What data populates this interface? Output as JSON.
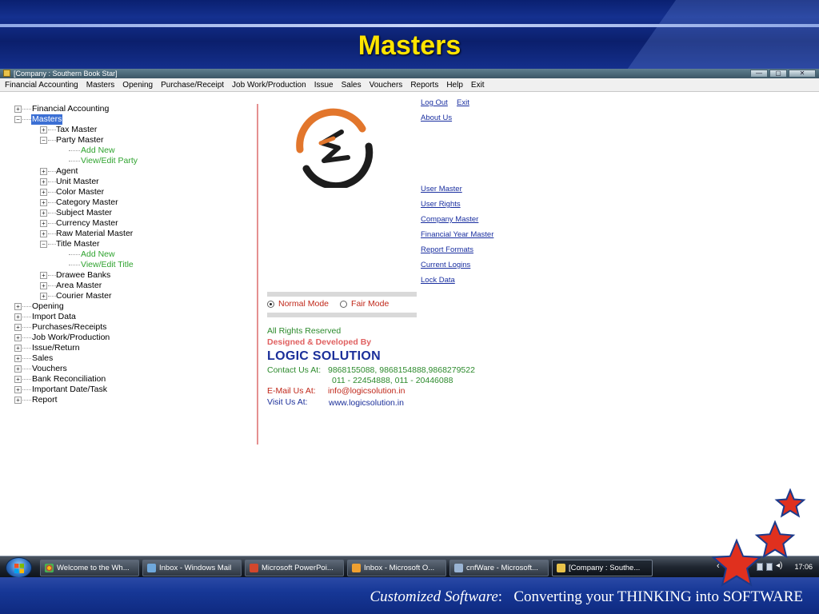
{
  "slide": {
    "title": "Masters",
    "tagline_em": "Customized Software",
    "tagline_colon": ":",
    "tagline_rest": "Converting your THINKING into SOFTWARE"
  },
  "window": {
    "title": "[Company : Southern Book Star]",
    "controls": [
      "—",
      "▢",
      "✕"
    ]
  },
  "menu": [
    "Financial Accounting",
    "Masters",
    "Opening",
    "Purchase/Receipt",
    "Job Work/Production",
    "Issue",
    "Sales",
    "Vouchers",
    "Reports",
    "Help",
    "Exit"
  ],
  "tree": {
    "financial_accounting": "Financial Accounting",
    "masters": "Masters",
    "tax_master": "Tax Master",
    "party_master": "Party Master",
    "party_add_new": "Add New",
    "party_view_edit": "View/Edit Party",
    "agent": "Agent",
    "unit_master": "Unit Master",
    "color_master": "Color Master",
    "category_master": "Category Master",
    "subject_master": "Subject Master",
    "currency_master": "Currency Master",
    "raw_material_master": "Raw Material Master",
    "title_master": "Title Master",
    "title_add_new": "Add New",
    "title_view_edit": "View/Edit Title",
    "drawee_banks": "Drawee Banks",
    "area_master": "Area Master",
    "courier_master": "Courier Master",
    "opening": "Opening",
    "import_data": "Import Data",
    "purchases_receipts": "Purchases/Receipts",
    "job_work_production": "Job Work/Production",
    "issue_return": "Issue/Return",
    "sales": "Sales",
    "vouchers": "Vouchers",
    "bank_reconciliation": "Bank Reconciliation",
    "important_date_task": "Important Date/Task",
    "report": "Report"
  },
  "links": {
    "log_out": "Log Out",
    "exit": "Exit",
    "about_us": "About Us",
    "user_master": "User Master",
    "user_rights": "User Rights",
    "company_master": "Company Master",
    "financial_year_master": "Financial Year Master",
    "report_formats": "Report Formats",
    "current_logins": "Current Logins",
    "lock_data": "Lock Data"
  },
  "modes": {
    "normal": "Normal Mode",
    "fair": "Fair Mode",
    "selected": "Normal Mode"
  },
  "credits": {
    "rights": "All Rights Reserved",
    "designed": "Designed & Developed By",
    "company": "LOGIC SOLUTION",
    "contact_label": "Contact Us At:",
    "contact_mobile": "9868155088, 9868154888,9868279522",
    "contact_phone": "011 - 22454888, 011 - 20446088",
    "email_label": "E-Mail Us At:",
    "email": "info@logicsolution.in",
    "visit_label": "Visit Us At:",
    "website": "www.logicsolution.in"
  },
  "taskbar": {
    "tasks": [
      "Welcome to the Wh...",
      "Inbox - Windows Mail",
      "Microsoft PowerPoi...",
      "Inbox - Microsoft O...",
      "cnfWare - Microsoft...",
      "[Company : Southe..."
    ],
    "clock": "17:06"
  },
  "colors": {
    "tree_leaf": "#2fa32f",
    "link": "#1a2fa0",
    "slide_title": "#ffe400",
    "divider": "#e59090",
    "star": "#e0301e"
  }
}
